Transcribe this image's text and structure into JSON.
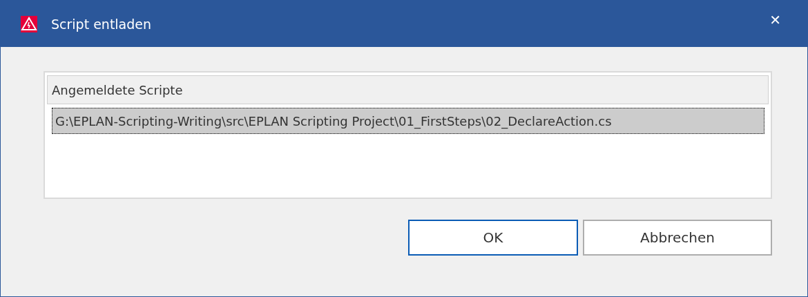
{
  "window": {
    "title": "Script entladen",
    "close": "✕"
  },
  "list": {
    "column": "Angemeldete Scripte",
    "rows": [
      {
        "text": "G:\\EPLAN-Scripting-Writing\\src\\EPLAN Scripting Project\\01_FirstSteps\\02_DeclareAction.cs",
        "selected": true
      }
    ]
  },
  "buttons": [
    {
      "label": "OK",
      "default": true
    },
    {
      "label": "Abbrechen",
      "default": false
    }
  ]
}
